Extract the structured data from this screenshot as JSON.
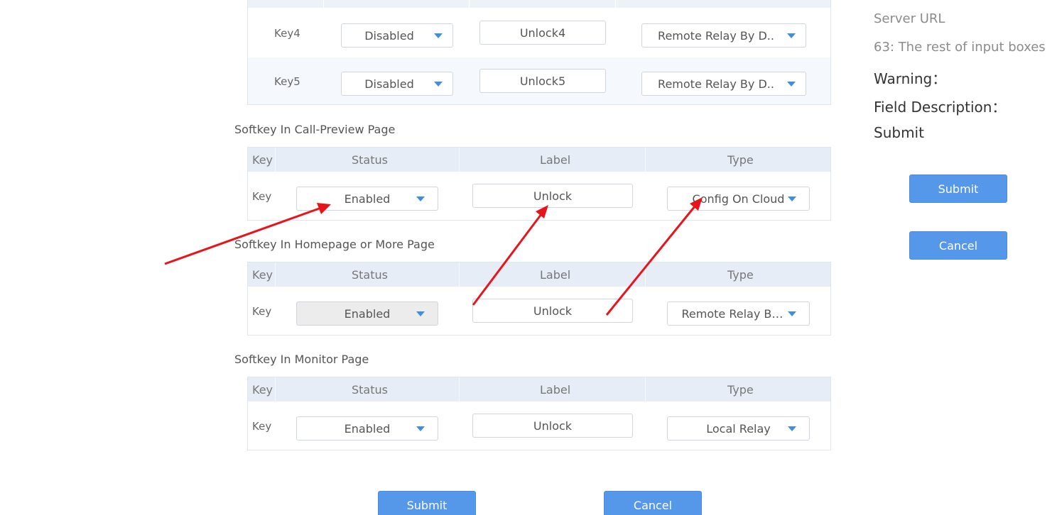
{
  "top_table": {
    "rows": [
      {
        "key": "Key4",
        "status": "Disabled",
        "label": "Unlock4",
        "type": "Remote Relay By D.."
      },
      {
        "key": "Key5",
        "status": "Disabled",
        "label": "Unlock5",
        "type": "Remote Relay By D.."
      }
    ]
  },
  "sections": [
    {
      "title": "Softkey In Call-Preview Page",
      "headers": {
        "key": "Key",
        "status": "Status",
        "label": "Label",
        "type": "Type"
      },
      "row": {
        "key": "Key",
        "status": "Enabled",
        "label": "Unlock",
        "type": "Config On Cloud",
        "status_disabled": false
      }
    },
    {
      "title": "Softkey In Homepage or More Page",
      "headers": {
        "key": "Key",
        "status": "Status",
        "label": "Label",
        "type": "Type"
      },
      "row": {
        "key": "Key",
        "status": "Enabled",
        "label": "Unlock",
        "type": "Remote Relay By H..",
        "status_disabled": true
      }
    },
    {
      "title": "Softkey In Monitor Page",
      "headers": {
        "key": "Key",
        "status": "Status",
        "label": "Label",
        "type": "Type"
      },
      "row": {
        "key": "Key",
        "status": "Enabled",
        "label": "Unlock",
        "type": "Local Relay",
        "status_disabled": false
      }
    }
  ],
  "bottom_buttons": {
    "submit": "Submit",
    "cancel": "Cancel"
  },
  "side_panel": {
    "server_url": "Server URL",
    "input_boxes": "63: The rest of input boxes",
    "warning": "Warning：",
    "field_description": "Field Description：",
    "submit_text": "Submit",
    "submit_button": "Submit",
    "cancel_button": "Cancel"
  },
  "colors": {
    "accent": "#5597e8",
    "arrow": "#e8141c",
    "header_bg": "#e6edf6"
  }
}
